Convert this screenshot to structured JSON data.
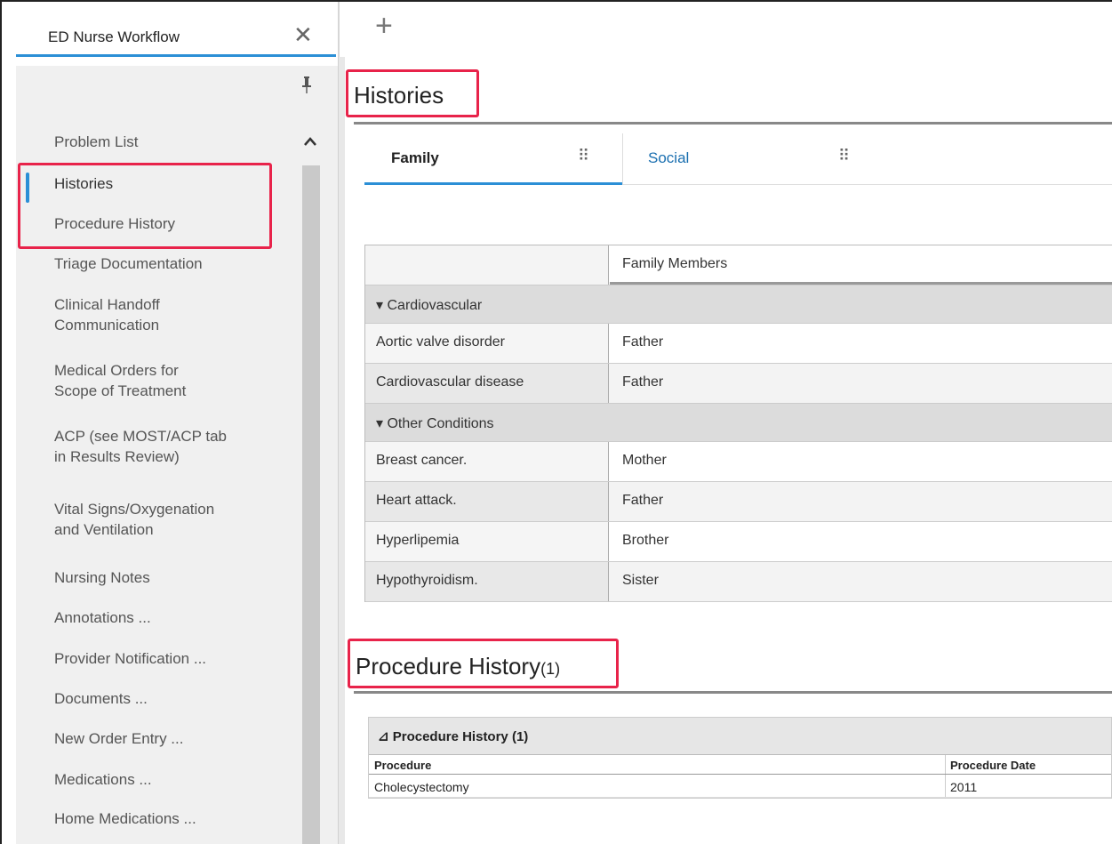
{
  "tabstrip": {
    "active_tab": "ED Nurse Workflow"
  },
  "sidebar": {
    "items": [
      {
        "label": "Problem List"
      },
      {
        "label": "Histories"
      },
      {
        "label": "Procedure History"
      },
      {
        "label": "Triage Documentation"
      },
      {
        "label": "Clinical Handoff\nCommunication"
      },
      {
        "label": "Medical Orders for\nScope of Treatment"
      },
      {
        "label": "ACP (see MOST/ACP tab\nin Results Review)"
      },
      {
        "label": "Vital Signs/Oxygenation\nand Ventilation"
      },
      {
        "label": "Nursing Notes"
      },
      {
        "label": "Annotations ..."
      },
      {
        "label": "Provider Notification ..."
      },
      {
        "label": "Documents ..."
      },
      {
        "label": "New Order Entry ..."
      },
      {
        "label": "Medications ..."
      },
      {
        "label": "Home Medications ..."
      }
    ]
  },
  "histories": {
    "title": "Histories",
    "tabs": [
      {
        "label": "Family"
      },
      {
        "label": "Social"
      }
    ],
    "table": {
      "column_header": "Family Members",
      "groups": [
        {
          "label": "Cardiovascular",
          "rows": [
            {
              "condition": "Aortic valve disorder",
              "member": "Father"
            },
            {
              "condition": "Cardiovascular disease",
              "member": "Father"
            }
          ]
        },
        {
          "label": "Other Conditions",
          "rows": [
            {
              "condition": "Breast cancer.",
              "member": "Mother"
            },
            {
              "condition": "Heart attack.",
              "member": "Father"
            },
            {
              "condition": "Hyperlipemia",
              "member": "Brother"
            },
            {
              "condition": "Hypothyroidism.",
              "member": "Sister"
            }
          ]
        }
      ]
    }
  },
  "procedure_history": {
    "title": "Procedure History",
    "count": "(1)",
    "panel_header": "⊿ Procedure History (1)",
    "columns": {
      "procedure": "Procedure",
      "date": "Procedure Date"
    },
    "rows": [
      {
        "procedure": "Cholecystectomy",
        "date": "2011"
      }
    ]
  },
  "colors": {
    "accent": "#2b8fd6",
    "highlight": "#e8234a"
  }
}
